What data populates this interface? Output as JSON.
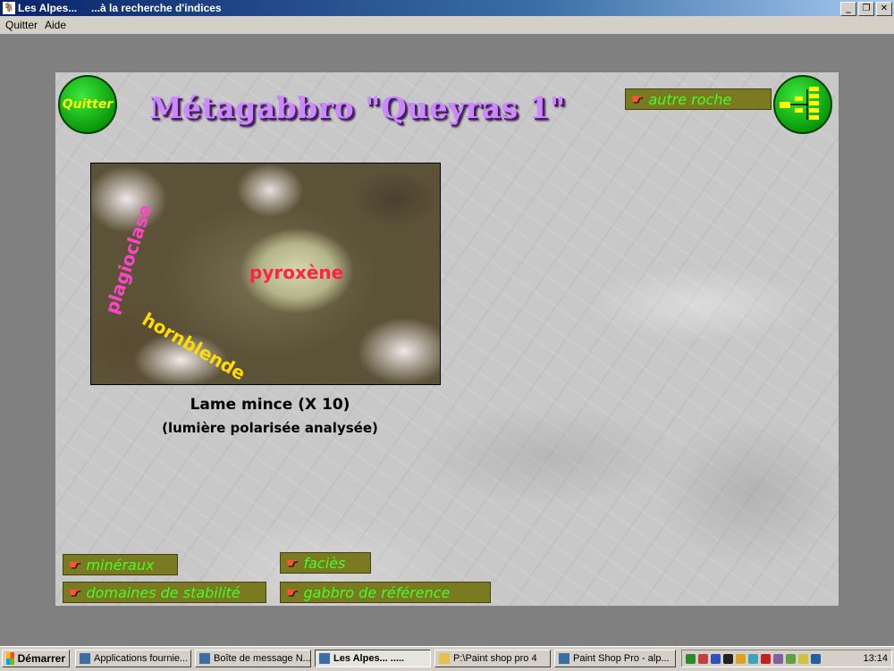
{
  "window": {
    "app_name": "Les Alpes...",
    "title": "...à la recherche d'indices",
    "minimize": "_",
    "restore": "❐",
    "close": "✕"
  },
  "menu": {
    "items": [
      "Quitter",
      "Aide"
    ]
  },
  "page": {
    "title": "Métagabbro \"Queyras 1\"",
    "quit_button": "Quitter",
    "other_rock": "autre roche",
    "caption_line1": "Lame mince (X 10)",
    "caption_line2": "(lumière polarisée analysée)"
  },
  "thin_section": {
    "labels": {
      "plagioclase": "plagioclase",
      "pyroxene": "pyroxène",
      "hornblende": "hornblende"
    }
  },
  "nav": {
    "minerals": "minéraux",
    "facies": "faciès",
    "stability": "domaines de stabilité",
    "reference": "gabbro de référence"
  },
  "taskbar": {
    "start": "Démarrer",
    "items": [
      "Applications fournie...",
      "Boîte de message N...",
      "Les Alpes...        .....",
      "P:\\Paint shop pro 4",
      "Paint Shop Pro - alp..."
    ],
    "clock": "13:14"
  },
  "icons": {
    "pointer": "pointing-hand-icon",
    "tree": "rock-tree-icon"
  },
  "colors": {
    "title": "#cc88ff",
    "link_text": "#44ff22",
    "link_bg": "#7a7a22",
    "quit_text": "#ffff00",
    "round_button": "#0a9a0a"
  }
}
